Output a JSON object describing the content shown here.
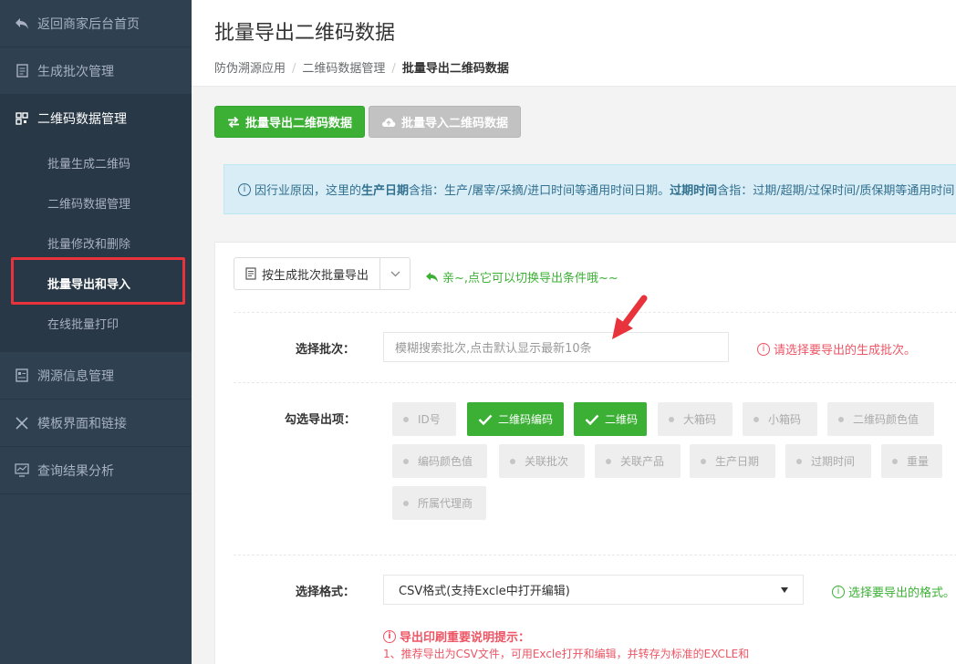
{
  "sidebar": {
    "back": "返回商家后台首页",
    "items": [
      {
        "label": "生成批次管理",
        "icon": "document-icon"
      },
      {
        "label": "二维码数据管理",
        "icon": "qrcode-icon"
      },
      {
        "label": "溯源信息管理",
        "icon": "document-list-icon"
      },
      {
        "label": "模板界面和链接",
        "icon": "puzzle-icon"
      },
      {
        "label": "查询结果分析",
        "icon": "monitor-chart-icon"
      }
    ],
    "sub_items": [
      "批量生成二维码",
      "二维码数据管理",
      "批量修改和删除",
      "批量导出和导入",
      "在线批量打印"
    ]
  },
  "header": {
    "title": "批量导出二维码数据",
    "breadcrumb": [
      "防伪溯源应用",
      "二维码数据管理",
      "批量导出二维码数据"
    ]
  },
  "actions": {
    "export_label": "批量导出二维码数据",
    "import_label": "批量导入二维码数据"
  },
  "alert": {
    "p1": "因行业原因，这里的",
    "b1": "生产日期",
    "p2": "含指：生产/屠宰/采摘/进口时间等通用时间日期。",
    "b2": "过期时间",
    "p3": "含指：过期/超期/过保时间/质保期等通用时间"
  },
  "form": {
    "mode_label": "按生成批次批量导出",
    "mode_hint": "亲~,点它可以切换导出条件哦~~",
    "batch_label": "选择批次：",
    "batch_placeholder": "模糊搜索批次,点击默认显示最新10条",
    "batch_error": "请选择要导出的生成批次。",
    "fields_label": "勾选导出项：",
    "fields": [
      {
        "label": "ID号",
        "checked": false
      },
      {
        "label": "二维码编码",
        "checked": true
      },
      {
        "label": "二维码",
        "checked": true
      },
      {
        "label": "大箱码",
        "checked": false
      },
      {
        "label": "小箱码",
        "checked": false
      },
      {
        "label": "二维码颜色值",
        "checked": false
      },
      {
        "label": "编码颜色值",
        "checked": false
      },
      {
        "label": "关联批次",
        "checked": false
      },
      {
        "label": "关联产品",
        "checked": false
      },
      {
        "label": "生产日期",
        "checked": false
      },
      {
        "label": "过期时间",
        "checked": false
      },
      {
        "label": "重量",
        "checked": false
      },
      {
        "label": "所属代理商",
        "checked": false
      }
    ],
    "format_label": "选择格式：",
    "format_value": "CSV格式(支持Excle中打开编辑)",
    "format_hint": "选择要导出的格式。",
    "notice_title": "导出印刷重要说明提示：",
    "notice_line1": "1、推荐导出为CSV文件，可用Excle打开和编辑，并转存为标准的EXCLE和"
  },
  "colors": {
    "sidebar_bg": "#2f4050",
    "accent_green": "#3cb035",
    "error_red": "#ed5565",
    "info_blue": "#31708f"
  }
}
